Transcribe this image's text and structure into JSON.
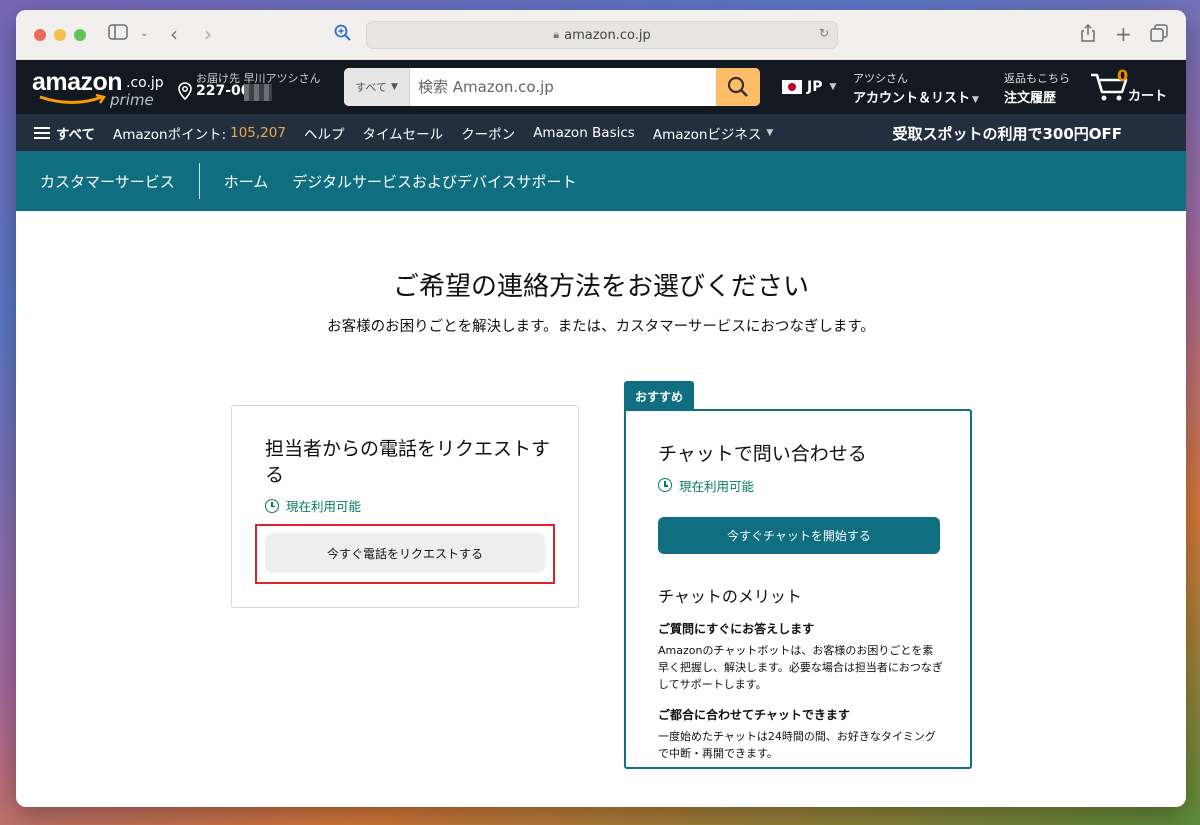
{
  "browser": {
    "url": "amazon.co.jp"
  },
  "header": {
    "logo_text": "amazon",
    "logo_domain": ".co.jp",
    "logo_prime": "prime",
    "deliver_line1": "お届け先 早川アツシさん",
    "deliver_line2": "227-00",
    "search_category": "すべて",
    "search_placeholder": "検索 Amazon.co.jp",
    "language": "JP",
    "account_line1": "アツシさん",
    "account_line2": "アカウント＆リスト",
    "returns_line1": "返品もこちら",
    "returns_line2": "注文履歴",
    "cart_count": "0",
    "cart_label": "カート"
  },
  "nav": {
    "all": "すべて",
    "points_label": "Amazonポイント:",
    "points_value": "105,207",
    "help": "ヘルプ",
    "timesale": "タイムセール",
    "coupon": "クーポン",
    "basics": "Amazon Basics",
    "business": "Amazonビジネス",
    "promo": "受取スポットの利用で300円OFF"
  },
  "subnav": {
    "customer_service": "カスタマーサービス",
    "home": "ホーム",
    "digital": "デジタルサービスおよびデバイスサポート"
  },
  "main": {
    "title": "ご希望の連絡方法をお選びください",
    "subtitle": "お客様のお困りごとを解決します。または、カスタマーサービスにおつなぎします。",
    "call_card": {
      "title": "担当者からの電話をリクエストする",
      "availability": "現在利用可能",
      "button": "今すぐ電話をリクエストする"
    },
    "chat_card": {
      "badge": "おすすめ",
      "title": "チャットで問い合わせる",
      "availability": "現在利用可能",
      "button": "今すぐチャットを開始する",
      "benefits_title": "チャットのメリット",
      "benefit1_title": "ご質問にすぐにお答えします",
      "benefit1_text": "Amazonのチャットボットは、お客様のお困りごとを素早く把握し、解決します。必要な場合は担当者におつなぎしてサポートします。",
      "benefit2_title": "ご都合に合わせてチャットできます",
      "benefit2_text": "一度始めたチャットは24時間の間、お好きなタイミングで中断・再開できます。"
    }
  },
  "colors": {
    "nav_dark": "#131921",
    "nav_secondary": "#232f3e",
    "teal": "#0f6e7f",
    "search_button": "#febd69",
    "highlight_red": "#d9262b"
  }
}
